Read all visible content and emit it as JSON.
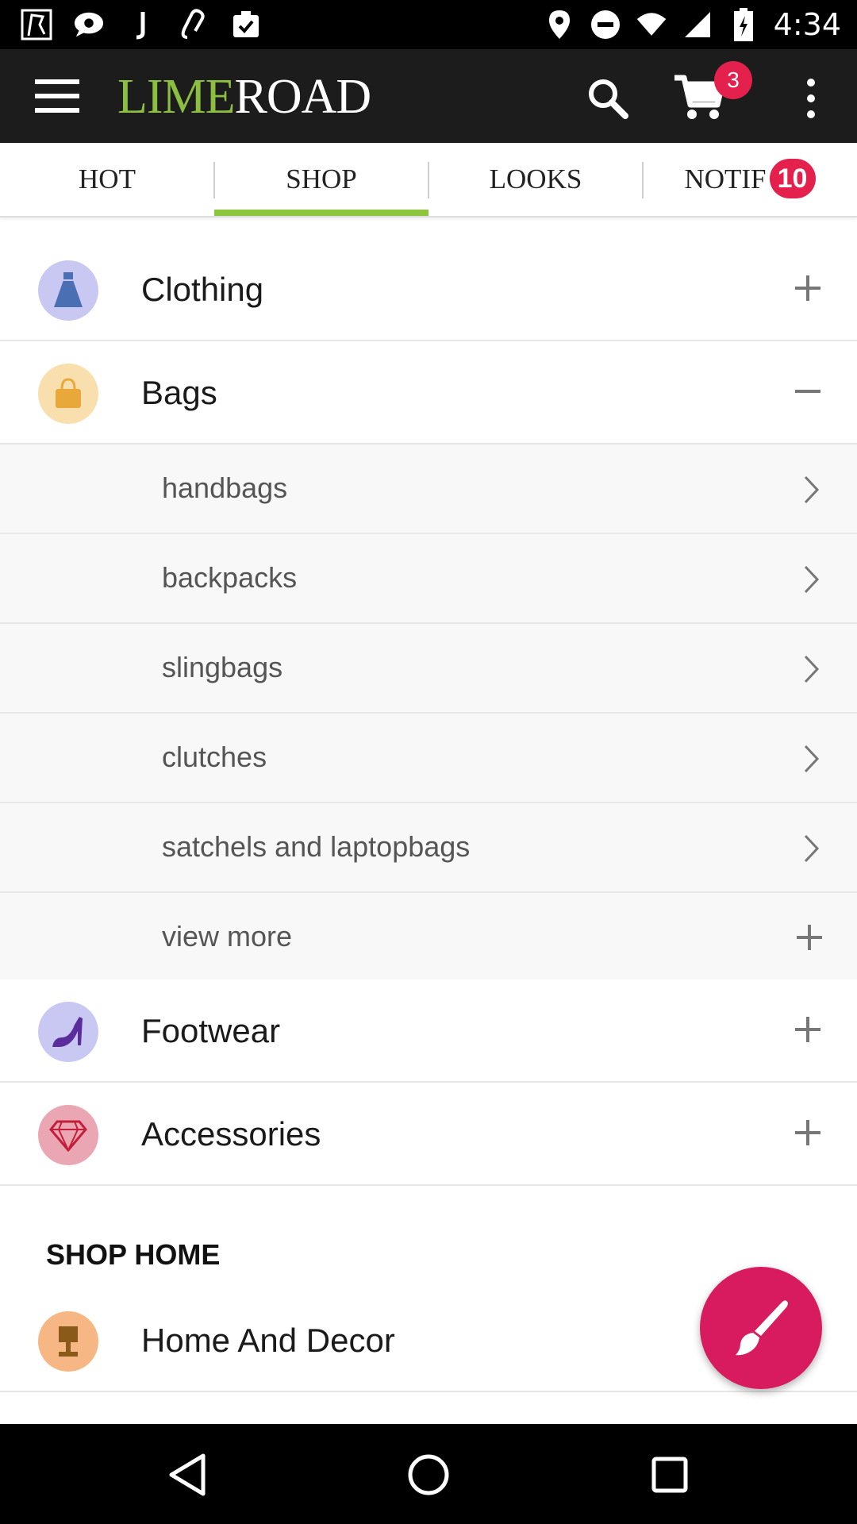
{
  "status_bar": {
    "time": "4:34",
    "left_icons": [
      "app-icon",
      "chat-icon",
      "j-icon",
      "link-icon",
      "clipboard-icon"
    ],
    "right_icons": [
      "location-icon",
      "do-not-disturb-icon",
      "wifi-icon",
      "signal-icon",
      "battery-charging-icon"
    ]
  },
  "app_bar": {
    "logo_part1": "LIME",
    "logo_part2": "ROAD",
    "cart_count": "3",
    "logo_colors": {
      "lime": "#8cbf3f",
      "road": "#ffffff"
    }
  },
  "tabs": [
    {
      "label": "HOT"
    },
    {
      "label": "SHOP",
      "active": true
    },
    {
      "label": "LOOKS"
    },
    {
      "label": "NOTIF",
      "badge": "10"
    }
  ],
  "categories": {
    "clothing": {
      "label": "Clothing",
      "icon": "dress-icon",
      "expanded": false
    },
    "bags": {
      "label": "Bags",
      "icon": "handbag-icon",
      "expanded": true,
      "subitems": [
        "handbags",
        "backpacks",
        "slingbags",
        "clutches",
        "satchels and laptopbags"
      ],
      "view_more": "view more"
    },
    "footwear": {
      "label": "Footwear",
      "icon": "high-heel-icon",
      "expanded": false
    },
    "accessories": {
      "label": "Accessories",
      "icon": "diamond-icon",
      "expanded": false
    }
  },
  "shop_home": {
    "title": "SHOP HOME",
    "items": [
      {
        "label": "Home And Decor",
        "icon": "lamp-icon"
      }
    ]
  },
  "fab": {
    "icon": "paintbrush-icon",
    "color": "#d81b5f"
  },
  "accent_colors": {
    "active_tab": "#8cc63f",
    "badge": "#e3214c"
  }
}
